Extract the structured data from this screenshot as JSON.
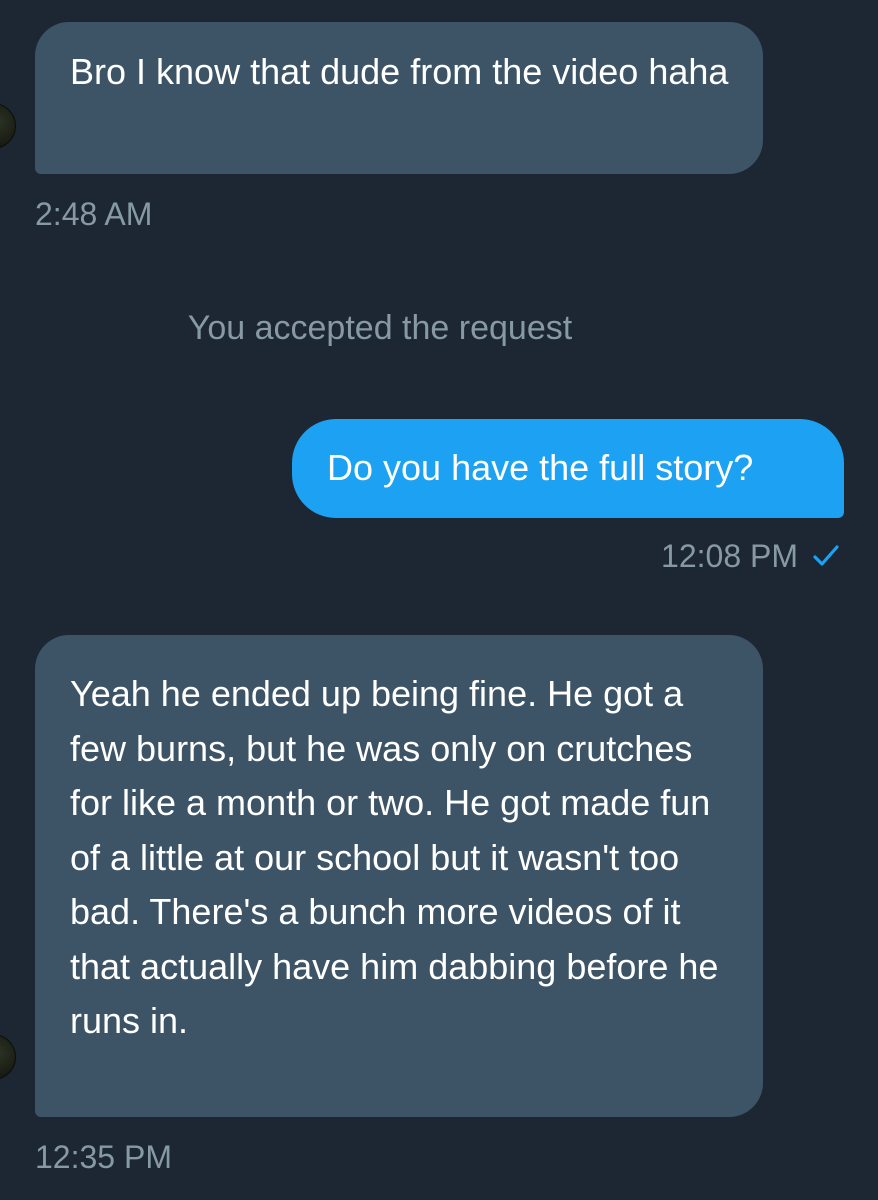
{
  "conversation": {
    "messages": [
      {
        "direction": "incoming",
        "text": "Bro I know that dude from the video haha",
        "time": "2:48 AM"
      },
      {
        "direction": "system",
        "text": "You accepted the request"
      },
      {
        "direction": "outgoing",
        "text": "Do you have the full story?",
        "time": "12:08 PM",
        "status_icon": "checkmark-icon"
      },
      {
        "direction": "incoming",
        "text": "Yeah he ended up being fine. He got a few burns, but he was only on crutches for like a month or two. He got made fun of a little at our school but it wasn't too bad. There's a bunch more videos of it that actually have him dabbing before he runs in.",
        "time": "12:35 PM"
      }
    ]
  },
  "colors": {
    "background": "#1c2733",
    "incoming_bubble": "#3d5466",
    "outgoing_bubble": "#1da1f2",
    "meta_text": "#8899a6",
    "check": "#1da1f2"
  }
}
